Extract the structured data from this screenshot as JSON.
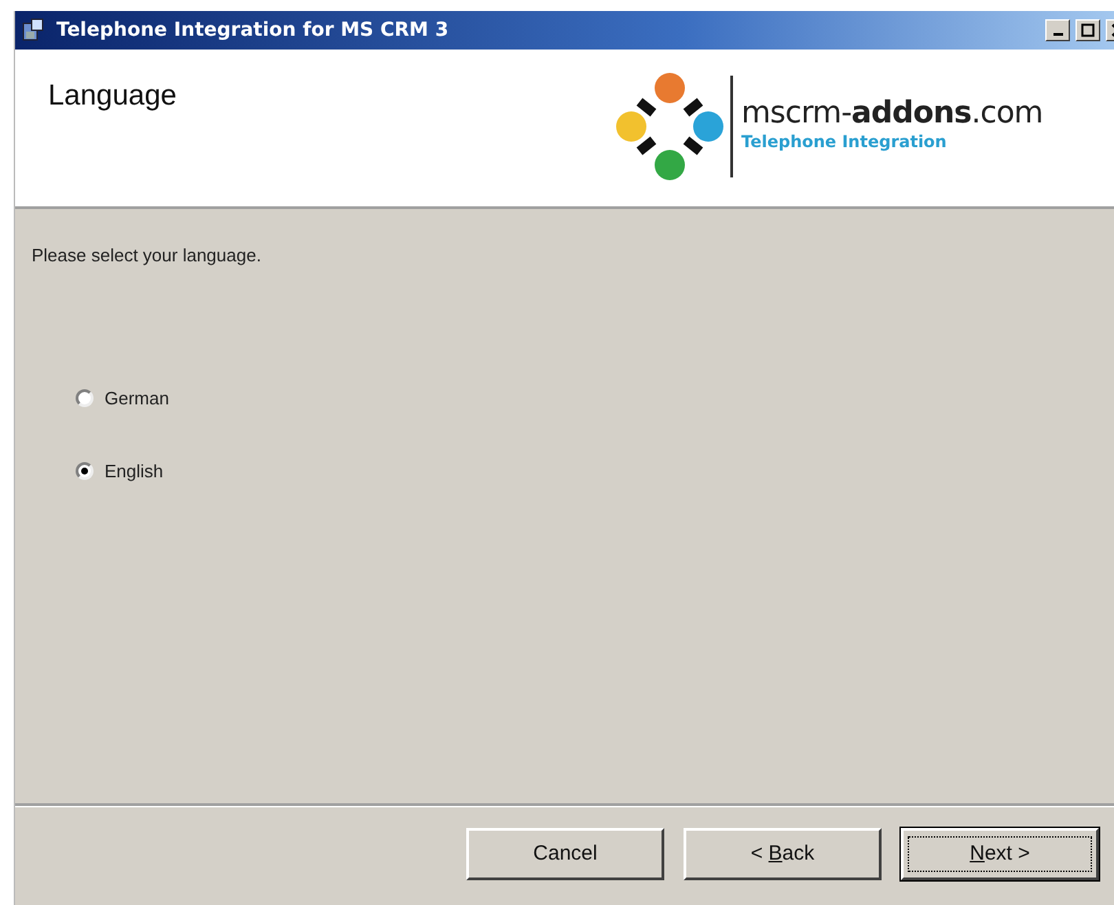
{
  "window": {
    "title": "Telephone Integration for MS CRM 3"
  },
  "header": {
    "title": "Language",
    "logo_text": "mscrm-**addons**.com",
    "logo_subtitle": "Telephone Integration"
  },
  "prompt": "Please select your language.",
  "options": [
    {
      "label": "German",
      "selected": false
    },
    {
      "label": "English",
      "selected": true
    }
  ],
  "buttons": [
    {
      "after": "Cancel",
      "default": false
    },
    {
      "before": "< ",
      "key": "B",
      "after": "ack",
      "default": false
    },
    {
      "key": "N",
      "after": "ext >",
      "default": true
    }
  ]
}
